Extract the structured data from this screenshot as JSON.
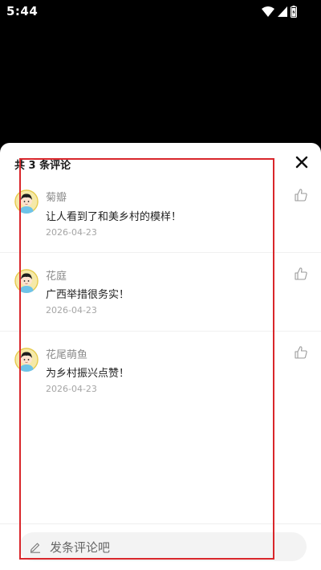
{
  "status_bar": {
    "time": "5:44",
    "icons": [
      "wifi-icon",
      "signal-icon",
      "battery-icon"
    ]
  },
  "sheet": {
    "title": "共 3 条评论",
    "close_icon": "close-icon"
  },
  "comments": [
    {
      "name": "菊瓣",
      "text": "让人看到了和美乡村的模样！",
      "date": "2026-04-23",
      "avatar_icon": "avatar"
    },
    {
      "name": "花庭",
      "text": "广西举措很务实！",
      "date": "2026-04-23",
      "avatar_icon": "avatar"
    },
    {
      "name": "花尾萌鱼",
      "text": "为乡村振兴点赞！",
      "date": "2026-04-23",
      "avatar_icon": "avatar"
    }
  ],
  "composer": {
    "placeholder": "发条评论吧",
    "icon": "pencil-icon"
  },
  "colors": {
    "highlight_border": "#d9262b",
    "text_primary": "#222222",
    "text_secondary": "#8c8c8c",
    "background_dark": "#000000"
  }
}
